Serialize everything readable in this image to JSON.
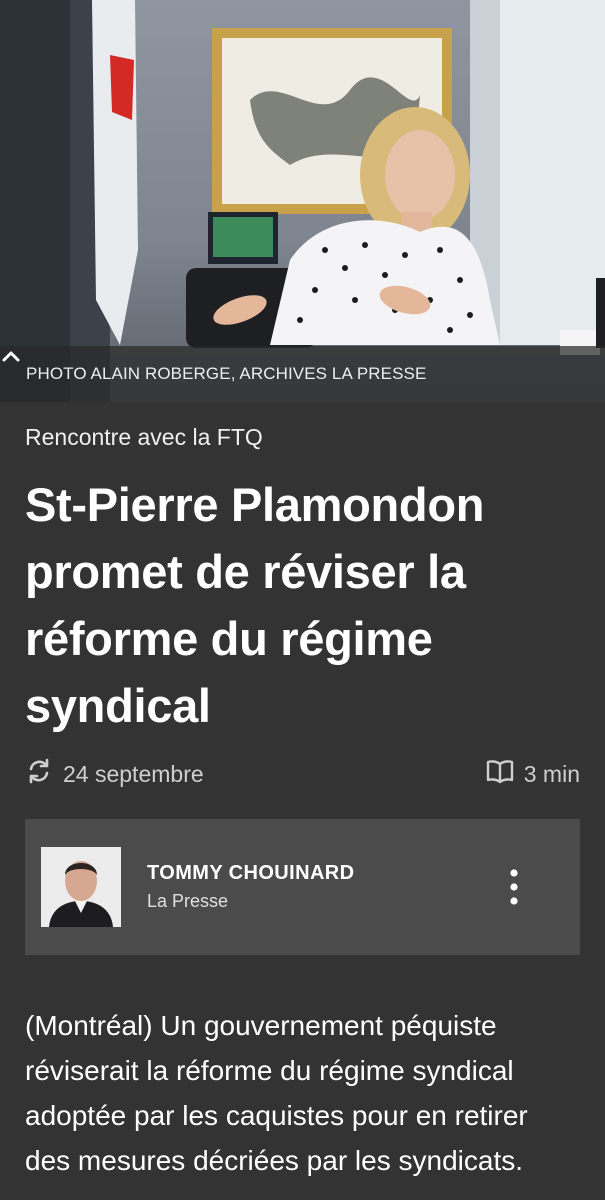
{
  "hero": {
    "caption": "PHOTO ALAIN ROBERGE, ARCHIVES LA PRESSE",
    "toggle_icon": "chevron-up-icon"
  },
  "article": {
    "kicker": "Rencontre avec la FTQ",
    "headline": "St-Pierre Plamondon promet de réviser la réforme du régime syndical",
    "date": "24 septembre",
    "date_icon": "refresh-icon",
    "read_time": "3 min",
    "read_time_icon": "book-icon",
    "lede": "(Montréal) Un gouvernement péquiste réviserait la réforme du régime syndical adoptée par les caquistes pour en retirer des mesures décriées par les syndicats."
  },
  "author": {
    "name": "TOMMY CHOUINARD",
    "organization": "La Presse",
    "menu_icon": "more-vertical-icon"
  },
  "colors": {
    "background": "#333333",
    "card": "#4b4b4b",
    "text": "#ffffff",
    "muted": "#cfcfcf"
  }
}
